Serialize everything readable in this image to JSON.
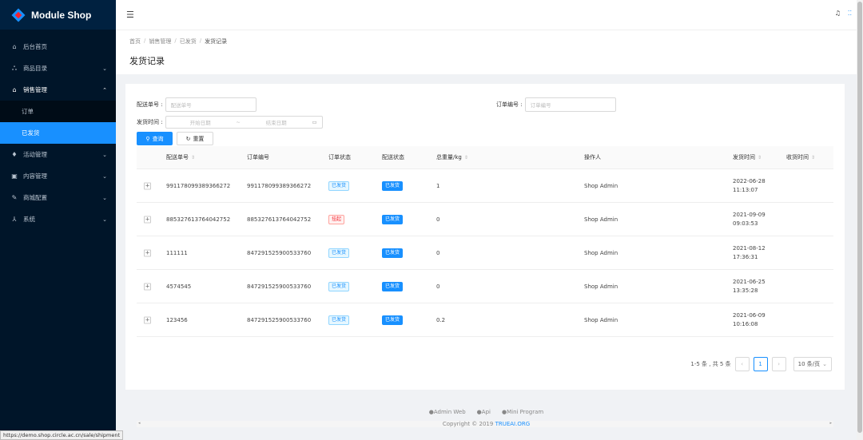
{
  "app": {
    "title": "Module Shop"
  },
  "sidebar": {
    "items": [
      {
        "label": "后台首页",
        "icon": "home-icon"
      },
      {
        "label": "商品目录",
        "icon": "tree-icon"
      },
      {
        "label": "销售管理",
        "icon": "shop-icon"
      },
      {
        "label": "活动管理",
        "icon": "bulb-icon"
      },
      {
        "label": "内容管理",
        "icon": "content-icon"
      },
      {
        "label": "商城配置",
        "icon": "tool-icon"
      },
      {
        "label": "系统",
        "icon": "user-icon"
      }
    ],
    "sub_items": [
      {
        "label": "订单"
      },
      {
        "label": "已发货"
      }
    ]
  },
  "breadcrumb": {
    "items": [
      "首页",
      "销售管理",
      "已发货",
      "发货记录"
    ]
  },
  "page": {
    "title": "发货记录"
  },
  "filters": {
    "shipping_no_label": "配送单号 :",
    "shipping_no_placeholder": "配送单号",
    "order_no_label": "订单编号 :",
    "order_no_placeholder": "订单编号",
    "ship_time_label": "发货时间 :",
    "start_placeholder": "开始日期",
    "range_sep": "~",
    "end_placeholder": "结束日期",
    "search_label": "查询",
    "reset_label": "重置"
  },
  "table": {
    "headers": {
      "shipping_no": "配送单号",
      "order_no": "订单编号",
      "order_status": "订单状态",
      "ship_status": "配送状态",
      "weight": "总重量/kg",
      "operator": "操作人",
      "ship_time": "发货时间",
      "receive_time": "收货时间"
    },
    "rows": [
      {
        "shipping_no": "991178099389366272",
        "order_no": "991178099389366272",
        "order_status": "已发货",
        "ship_status": "已发货",
        "weight": "1",
        "operator": "Shop Admin",
        "ship_date": "2022-06-28",
        "ship_clock": "11:13:07"
      },
      {
        "shipping_no": "885327613764042752",
        "order_no": "885327613764042752",
        "order_status": "挂起",
        "ship_status": "已发货",
        "weight": "0",
        "operator": "Shop Admin",
        "ship_date": "2021-09-09",
        "ship_clock": "09:03:53"
      },
      {
        "shipping_no": "111111",
        "order_no": "847291525900533760",
        "order_status": "已发货",
        "ship_status": "已发货",
        "weight": "0",
        "operator": "Shop Admin",
        "ship_date": "2021-08-12",
        "ship_clock": "17:36:31"
      },
      {
        "shipping_no": "4574545",
        "order_no": "847291525900533760",
        "order_status": "已发货",
        "ship_status": "已发货",
        "weight": "0",
        "operator": "Shop Admin",
        "ship_date": "2021-06-25",
        "ship_clock": "13:35:28"
      },
      {
        "shipping_no": "123456",
        "order_no": "847291525900533760",
        "order_status": "已发货",
        "ship_status": "已发货",
        "weight": "0.2",
        "operator": "Shop Admin",
        "ship_date": "2021-06-09",
        "ship_clock": "10:16:08"
      }
    ]
  },
  "pagination": {
    "summary": "1-5 条 , 共 5 条",
    "current": "1",
    "page_size": "10 条/页"
  },
  "footer": {
    "links": [
      "Admin Web",
      "Api",
      "Mini Program"
    ],
    "copyright": "Copyright © 2019",
    "org": "TRUEAI.ORG"
  },
  "status_url": "https://demo.shop.circle.ac.cn/sale/shipment",
  "colors": {
    "primary": "#1890ff",
    "sidebar": "#001529",
    "danger": "#f5222d"
  }
}
